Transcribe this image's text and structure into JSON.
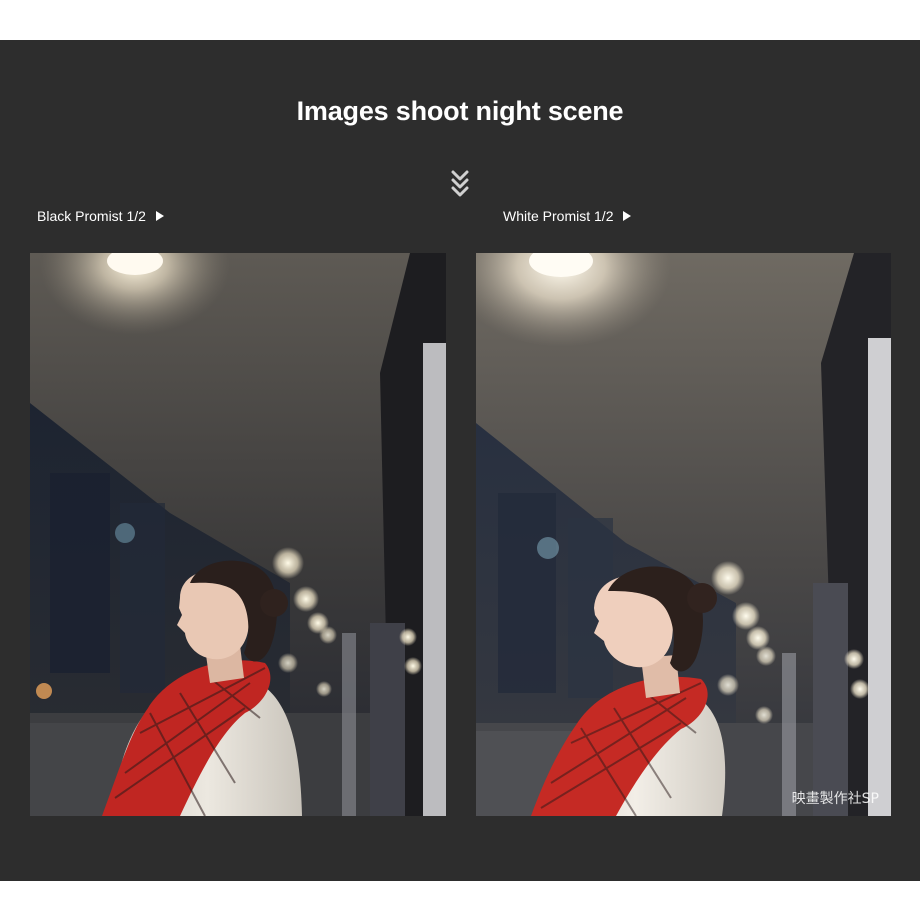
{
  "header": {
    "title": "Images shoot night scene"
  },
  "icons": {
    "scroll": "double-chevron-down-icon",
    "play": "play-triangle-icon"
  },
  "colors": {
    "panel": "#2d2d2d",
    "page": "#ffffff",
    "text": "#ffffff",
    "scarf": "#c4261f",
    "coat": "#eae6df"
  },
  "comparison": {
    "left": {
      "label": "Black Promist 1/2"
    },
    "right": {
      "label": "White Promist 1/2",
      "watermark": "映畫製作社SP"
    }
  }
}
